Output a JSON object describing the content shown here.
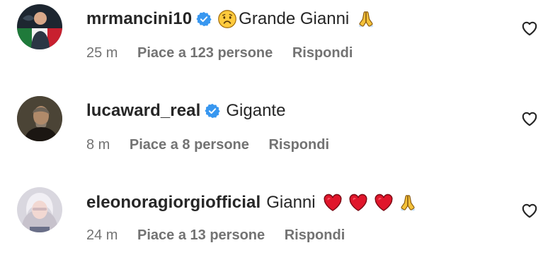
{
  "comments": [
    {
      "username": "mrmancini10",
      "verified": true,
      "text": "Grande Gianni",
      "time": "25 m",
      "likes": "Piace a 123 persone",
      "reply": "Rispondi"
    },
    {
      "username": "lucaward_real",
      "verified": true,
      "text": "Gigante",
      "time": "8 m",
      "likes": "Piace a 8 persone",
      "reply": "Rispondi"
    },
    {
      "username": "eleonoragiorgiofficial",
      "verified": false,
      "text": "Gianni",
      "time": "24 m",
      "likes": "Piace a 13 persone",
      "reply": "Rispondi"
    }
  ],
  "icons": {
    "verified": "verified-badge-icon",
    "sad_face": "sad-face-emoji-icon",
    "folded_hands": "folded-hands-emoji-icon",
    "red_heart": "red-heart-emoji-icon",
    "like": "heart-outline-icon"
  },
  "colors": {
    "verified_blue": "#3897f0",
    "meta_gray": "#737373",
    "heart_red": "#e0162b"
  }
}
